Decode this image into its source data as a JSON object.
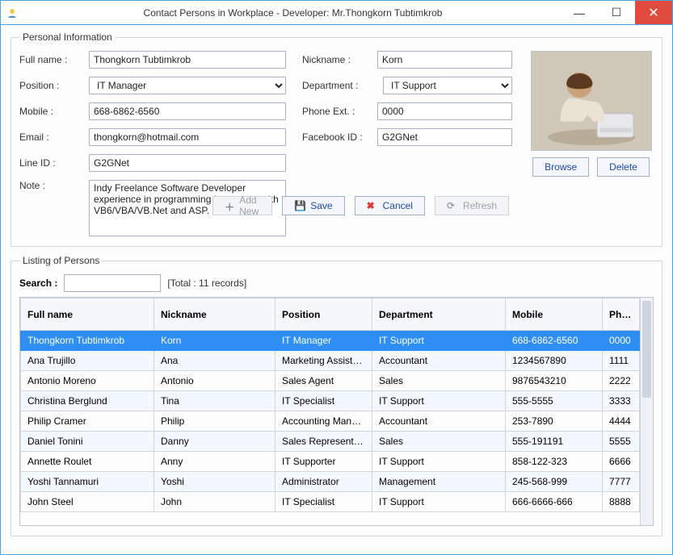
{
  "window": {
    "title": "Contact Persons in Workplace - Developer: Mr.Thongkorn Tubtimkrob"
  },
  "group": {
    "personal": "Personal Information",
    "listing": "Listing of Persons"
  },
  "labels": {
    "fullname": "Full name :",
    "position": "Position :",
    "mobile": "Mobile :",
    "email": "Email :",
    "lineid": "Line ID :",
    "note": "Note :",
    "nickname": "Nickname :",
    "department": "Department :",
    "phoneext": "Phone Ext. :",
    "facebook": "Facebook ID :"
  },
  "fields": {
    "fullname": "Thongkorn Tubtimkrob",
    "position": "IT Manager",
    "mobile": "668-6862-6560",
    "email": "thongkorn@hotmail.com",
    "lineid": "G2GNet",
    "note": "Indy Freelance Software Developer experience in programming languages with VB6/VBA/VB.Net and ASP.",
    "nickname": "Korn",
    "department": "IT Support",
    "phoneext": "0000",
    "facebook": "G2GNet"
  },
  "buttons": {
    "browse": "Browse",
    "delete": "Delete",
    "addnew": "Add New",
    "save": "Save",
    "cancel": "Cancel",
    "refresh": "Refresh"
  },
  "search": {
    "label": "Search :",
    "value": "",
    "total": "[Total : 11 records]"
  },
  "columns": {
    "fullname": "Full name",
    "nickname": "Nickname",
    "position": "Position",
    "department": "Department",
    "mobile": "Mobile",
    "phoneext": "Phone Ext."
  },
  "rows": [
    {
      "fullname": "Thongkorn Tubtimkrob",
      "nickname": "Korn",
      "position": "IT Manager",
      "department": "IT Support",
      "mobile": "668-6862-6560",
      "phoneext": "0000",
      "selected": true
    },
    {
      "fullname": "Ana Trujillo",
      "nickname": "Ana",
      "position": "Marketing Assistant",
      "department": "Accountant",
      "mobile": "1234567890",
      "phoneext": "1111"
    },
    {
      "fullname": "Antonio Moreno",
      "nickname": "Antonio",
      "position": "Sales Agent",
      "department": "Sales",
      "mobile": "9876543210",
      "phoneext": "2222"
    },
    {
      "fullname": "Christina Berglund",
      "nickname": "Tina",
      "position": "IT Specialist",
      "department": "IT Support",
      "mobile": "555-5555",
      "phoneext": "3333"
    },
    {
      "fullname": "Philip Cramer",
      "nickname": "Philip",
      "position": "Accounting Manager",
      "department": "Accountant",
      "mobile": "253-7890",
      "phoneext": "4444"
    },
    {
      "fullname": "Daniel Tonini",
      "nickname": "Danny",
      "position": "Sales Representative",
      "department": "Sales",
      "mobile": "555-191191",
      "phoneext": "5555"
    },
    {
      "fullname": "Annette Roulet",
      "nickname": "Anny",
      "position": "IT Supporter",
      "department": "IT Support",
      "mobile": "858-122-323",
      "phoneext": "6666"
    },
    {
      "fullname": "Yoshi Tannamuri",
      "nickname": "Yoshi",
      "position": "Administrator",
      "department": "Management",
      "mobile": "245-568-999",
      "phoneext": "7777"
    },
    {
      "fullname": "John Steel",
      "nickname": "John",
      "position": "IT Specialist",
      "department": "IT Support",
      "mobile": "666-6666-666",
      "phoneext": "8888"
    }
  ]
}
